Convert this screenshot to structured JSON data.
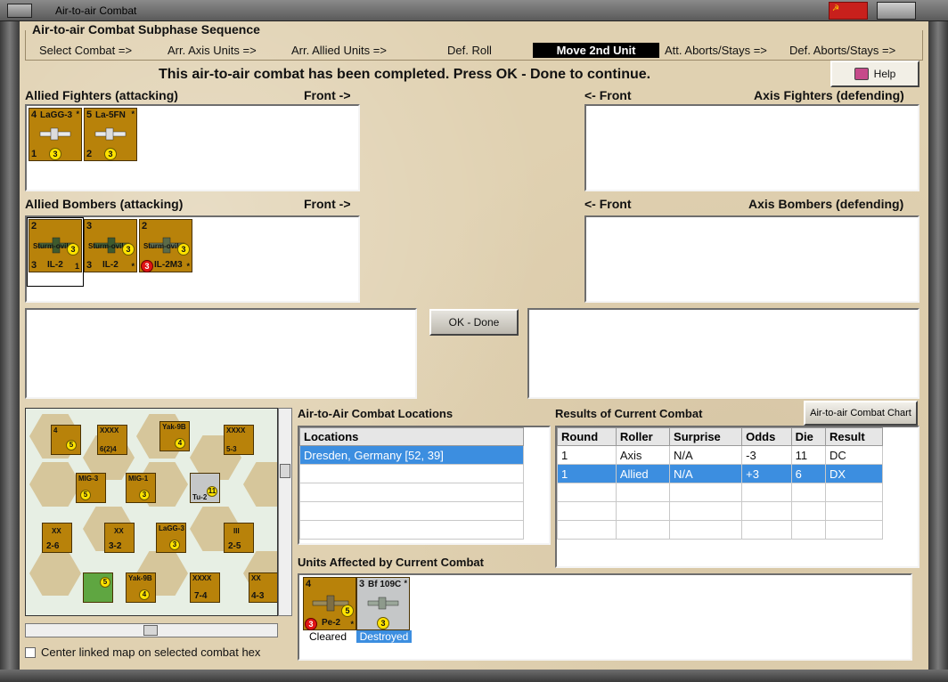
{
  "window": {
    "title": "Air-to-air Combat"
  },
  "sequence": {
    "heading": "Air-to-air Combat Subphase Sequence",
    "steps": [
      "Select Combat =>",
      "Arr. Axis Units =>",
      "Arr. Allied Units =>",
      "Def. Roll",
      "Move 2nd Unit",
      "Att. Aborts/Stays =>",
      "Def. Aborts/Stays =>"
    ],
    "active_step": "Move 2nd Unit"
  },
  "status_message": "This air-to-air combat has been completed.  Press OK - Done to continue.",
  "help_button": "Help",
  "sections": {
    "allied_fighters": "Allied Fighters (attacking)",
    "allied_fighters_front": "Front ->",
    "axis_fighters_front": "<- Front",
    "axis_fighters": "Axis Fighters (defending)",
    "allied_bombers": "Allied Bombers (attacking)",
    "allied_bombers_front": "Front ->",
    "axis_bombers_front": "<- Front",
    "axis_bombers": "Axis Bombers (defending)"
  },
  "allied_fighters": [
    {
      "tl": "4",
      "name": "LaGG-3",
      "bl": "1",
      "dot": "3",
      "star": "*"
    },
    {
      "tl": "5",
      "name": "La-5FN",
      "bl": "2",
      "dot": "3",
      "star": "*"
    }
  ],
  "allied_bombers": [
    {
      "tl": "2",
      "name": "IL-2",
      "bl": "3",
      "br": "1",
      "dot": "3",
      "mid": "Sturm-ovik"
    },
    {
      "tl": "3",
      "name": "IL-2",
      "bl": "3",
      "br": "*",
      "dot": "3",
      "mid": "Sturm-ovik"
    },
    {
      "tl": "2",
      "name": "IL-2M3",
      "red": "3",
      "br": "*",
      "dot": "3",
      "mid": "Sturm-ovik"
    }
  ],
  "ok_button": "OK - Done",
  "locations": {
    "heading": "Air-to-Air Combat Locations",
    "column": "Locations",
    "rows": [
      "Dresden, Germany [52, 39]"
    ]
  },
  "results": {
    "heading": "Results of Current Combat",
    "chart_button": "Air-to-air Combat Chart",
    "columns": [
      "Round",
      "Roller",
      "Surprise",
      "Odds",
      "Die",
      "Result"
    ],
    "rows": [
      [
        "1",
        "Axis",
        "N/A",
        "-3",
        "11",
        "DC"
      ],
      [
        "1",
        "Allied",
        "N/A",
        "+3",
        "6",
        "DX"
      ]
    ]
  },
  "affected": {
    "heading": "Units Affected by Current Combat",
    "units": [
      {
        "tl": "4",
        "name": "Pe-2",
        "red": "3",
        "dot": "5",
        "star": "*",
        "status": "Cleared"
      },
      {
        "tl": "3",
        "name": "Bf 109C",
        "dot": "3",
        "star": "*",
        "status": "Destroyed"
      }
    ]
  },
  "map": {
    "counters": [
      {
        "label": "4",
        "name": "",
        "dot": "5"
      },
      {
        "label": "XXXX",
        "name": "6(2)4",
        "dot": ""
      },
      {
        "label": "Yak-9B",
        "name": "",
        "dot": "4"
      },
      {
        "label": "XXXX",
        "name": "5-3",
        "dot": ""
      },
      {
        "label": "MIG-3",
        "name": "",
        "dot": "5"
      },
      {
        "label": "MIG-1",
        "name": "",
        "dot": "3"
      },
      {
        "label": "Tu-2",
        "name": "",
        "dot": "11"
      },
      {
        "label": "XX",
        "name": "2-6",
        "dot": ""
      },
      {
        "label": "XX",
        "name": "3-2",
        "dot": ""
      },
      {
        "label": "LaGG-3",
        "name": "",
        "dot": "3"
      },
      {
        "label": "III",
        "name": "2-5",
        "dot": ""
      },
      {
        "label": "Yak-9B",
        "name": "",
        "dot": "4"
      },
      {
        "label": "XXXX",
        "name": "7-4",
        "dot": ""
      },
      {
        "label": "B-25C",
        "name": "",
        "dot": "5"
      },
      {
        "label": "XX",
        "name": "4-3",
        "dot": ""
      }
    ],
    "checkbox_label": "Center linked map on selected combat hex"
  },
  "colors": {
    "background": "#e0d1b1",
    "counter": "#b8820a",
    "selection": "#3c8ee0",
    "active_step_bg": "#000000"
  }
}
